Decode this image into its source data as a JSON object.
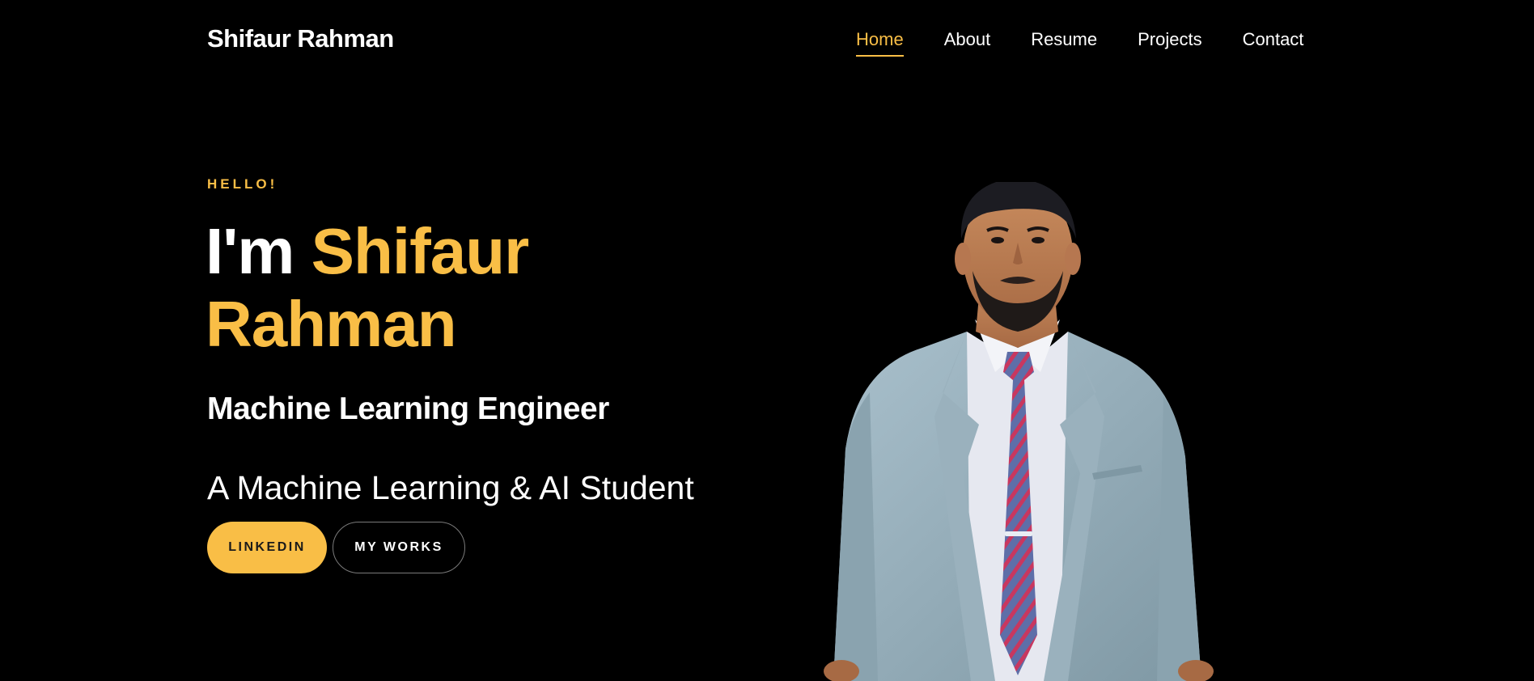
{
  "header": {
    "brand": "Shifaur Rahman",
    "nav": [
      {
        "label": "Home",
        "active": true
      },
      {
        "label": "About",
        "active": false
      },
      {
        "label": "Resume",
        "active": false
      },
      {
        "label": "Projects",
        "active": false
      },
      {
        "label": "Contact",
        "active": false
      }
    ]
  },
  "hero": {
    "greeting": "HELLO!",
    "title_prefix": "I'm",
    "title_name_line1": "Shifaur",
    "title_name_line2": "Rahman",
    "role": "Machine Learning Engineer",
    "tagline": "A Machine Learning & AI Student",
    "buttons": {
      "primary": "LINKEDIN",
      "secondary": "MY WORKS"
    },
    "portrait_icon": "person-portrait-icon"
  },
  "colors": {
    "background": "#000000",
    "accent": "#f9be46",
    "text": "#ffffff"
  }
}
